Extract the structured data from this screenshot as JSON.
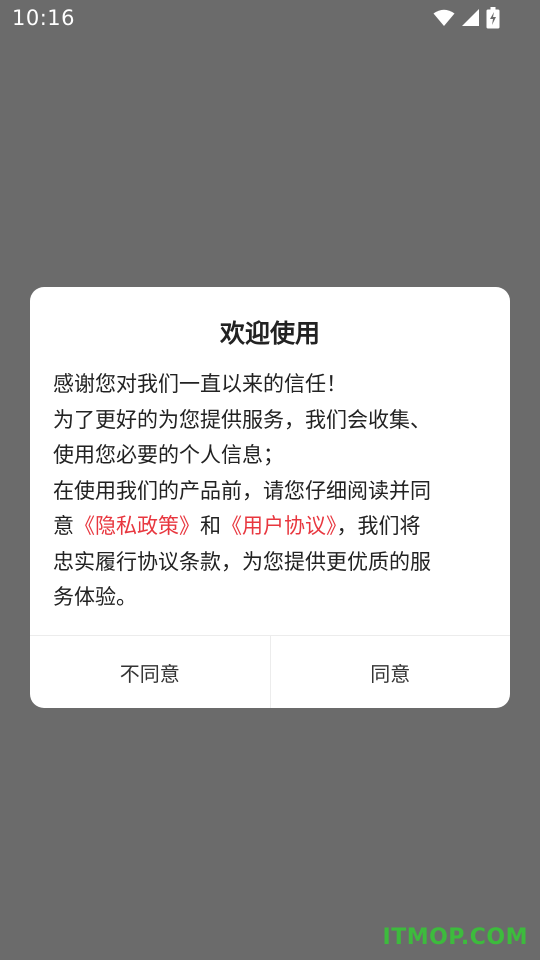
{
  "status_bar": {
    "time": "10:16",
    "icons": [
      "wifi-icon",
      "cellular-signal-icon",
      "battery-charging-icon"
    ]
  },
  "dialog": {
    "title": "欢迎使用",
    "lines": {
      "line1": "感谢您对我们一直以来的信任！",
      "line2": "为了更好的为您提供服务，我们会收集、",
      "line3": "使用您必要的个人信息；",
      "line4": "在使用我们的产品前，请您仔细阅读并同",
      "line5_prefix": "意",
      "privacy_link": "《隐私政策》",
      "line5_and": "和",
      "agreement_link": "《用户协议》",
      "line5_suffix": "，我们将",
      "line6": "忠实履行协议条款，为您提供更优质的服",
      "line7": "务体验。"
    },
    "decline_label": "不同意",
    "agree_label": "同意"
  },
  "watermark": "ITMOP.COM",
  "colors": {
    "backdrop": "#6b6b6b",
    "link": "#e8373f",
    "watermark": "#3dbb3d"
  }
}
